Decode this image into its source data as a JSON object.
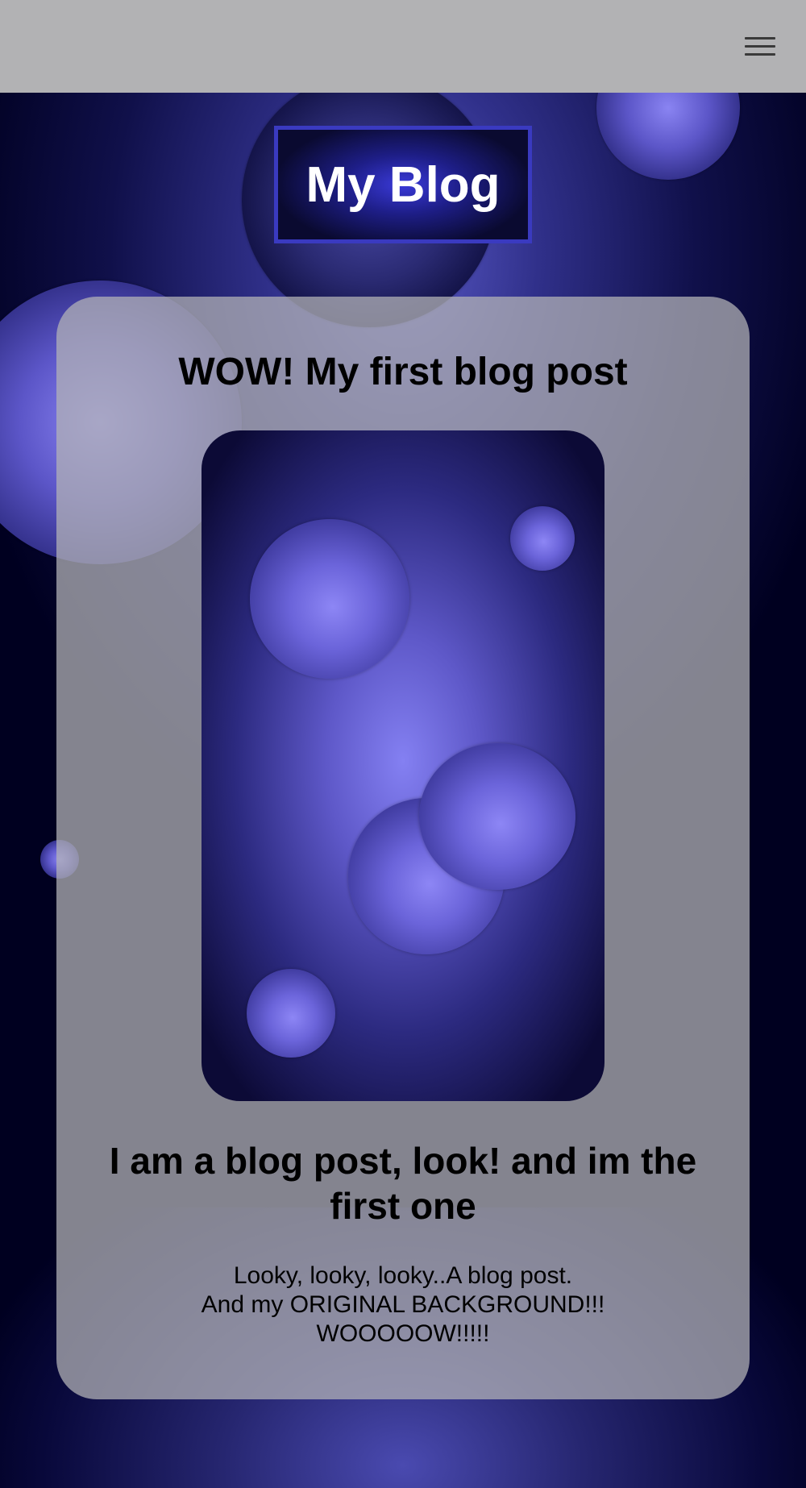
{
  "header": {
    "menu_icon": "hamburger-menu-icon"
  },
  "logo": {
    "title": "My Blog"
  },
  "post": {
    "title": "WOW! My first blog post",
    "image": "bubbles-image",
    "heading": "I am a blog post, look! and im the first one",
    "body_lines": [
      "Looky, looky, looky..A blog post.",
      "And my ORIGINAL BACKGROUND!!!",
      "WOOOOOW!!!!!"
    ]
  },
  "colors": {
    "topbar": "#b2b2b4",
    "logo_border": "#3a3ac0",
    "background_dark": "#00001e",
    "accent_purple": "#8480f2"
  }
}
